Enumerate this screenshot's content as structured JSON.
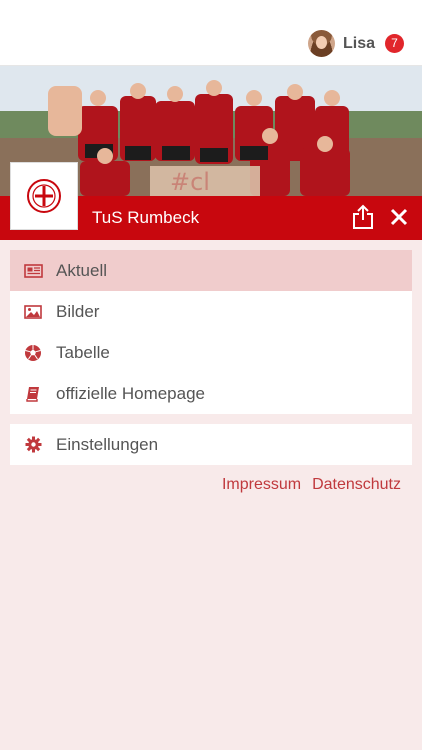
{
  "user": {
    "name": "Lisa",
    "notification_count": "7"
  },
  "club": {
    "name": "TuS Rumbeck"
  },
  "menu": {
    "items": [
      {
        "label": "Aktuell",
        "icon": "newspaper-icon"
      },
      {
        "label": "Bilder",
        "icon": "image-icon"
      },
      {
        "label": "Tabelle",
        "icon": "soccer-ball-icon"
      },
      {
        "label": "offizielle Homepage",
        "icon": "book-icon"
      }
    ],
    "settings_label": "Einstellungen",
    "settings_icon": "gear-icon"
  },
  "footer": {
    "impressum": "Impressum",
    "datenschutz": "Datenschutz"
  },
  "colors": {
    "brand_red": "#c8070e",
    "active_bg": "#f0cccc",
    "page_bg": "#f8eaea",
    "badge_red": "#e1262b",
    "link_red": "#c0393d"
  }
}
